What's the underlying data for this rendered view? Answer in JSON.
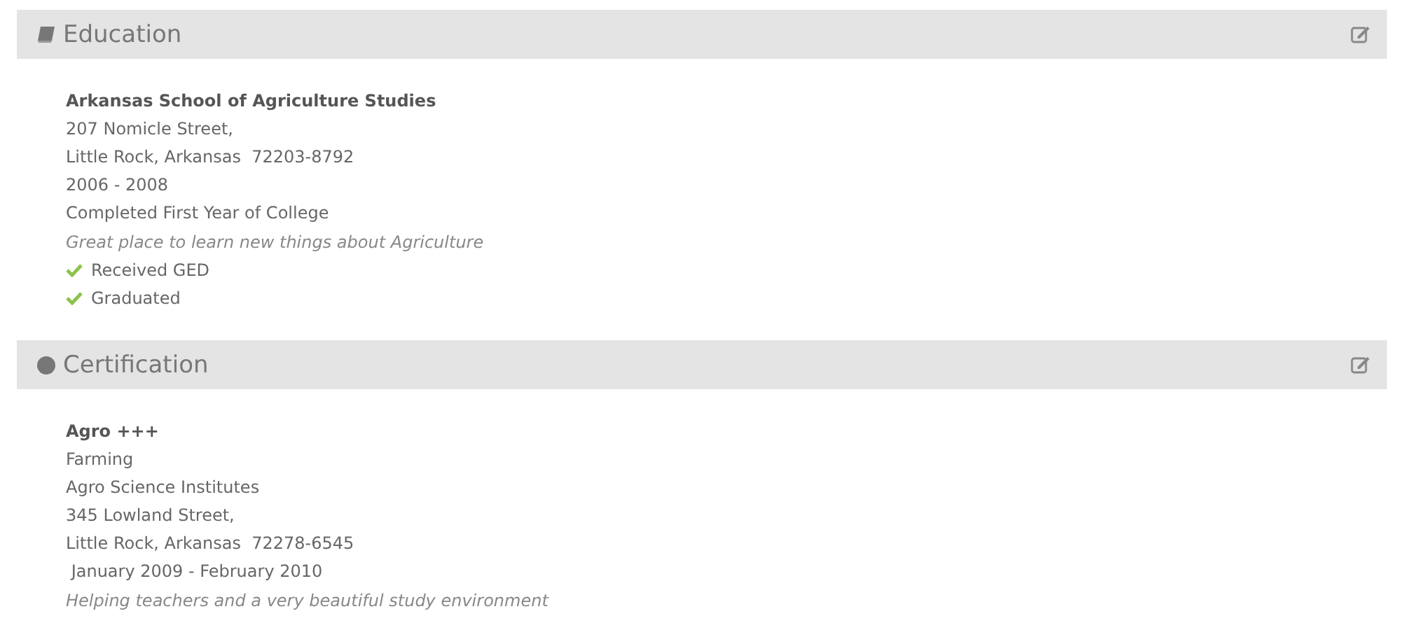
{
  "sections": [
    {
      "title": "Education",
      "kind": "book",
      "lines": [
        {
          "kind": "title",
          "text": "Arkansas School of Agriculture Studies"
        },
        {
          "kind": "text",
          "text": "207 Nomicle Street,"
        },
        {
          "kind": "text",
          "text": "Little Rock, Arkansas  72203-8792"
        },
        {
          "kind": "text",
          "text": "2006 - 2008"
        },
        {
          "kind": "text",
          "text": "Completed First Year of College"
        },
        {
          "kind": "note",
          "text": "Great place to learn new things about Agriculture"
        },
        {
          "kind": "check",
          "text": "Received GED"
        },
        {
          "kind": "check",
          "text": "Graduated"
        }
      ]
    },
    {
      "title": "Certification",
      "kind": "circle",
      "lines": [
        {
          "kind": "title",
          "text": "Agro +++"
        },
        {
          "kind": "text",
          "text": "Farming"
        },
        {
          "kind": "text",
          "text": "Agro Science Institutes"
        },
        {
          "kind": "text",
          "text": "345 Lowland Street,"
        },
        {
          "kind": "text",
          "text": "Little Rock, Arkansas  72278-6545"
        },
        {
          "kind": "text",
          "text": " January 2009 - February 2010"
        },
        {
          "kind": "note",
          "text": "Helping teachers and a very beautiful study environment"
        }
      ]
    }
  ]
}
